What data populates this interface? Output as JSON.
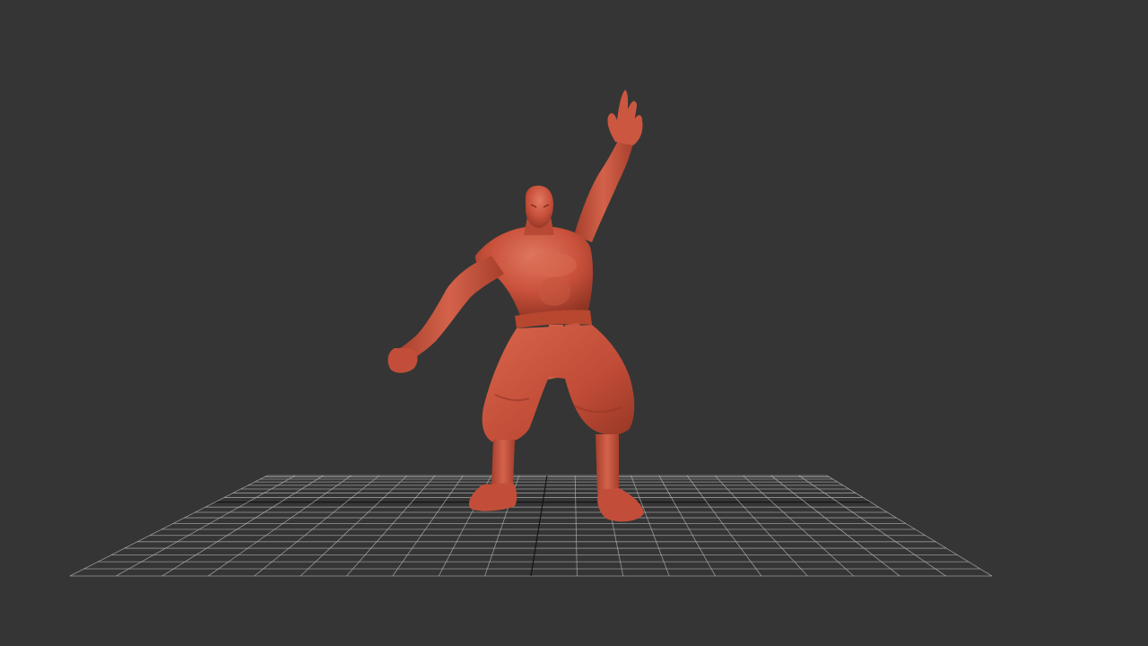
{
  "viewport": {
    "background_color": "#353535",
    "grid_line_color": "#b8b8b8",
    "grid_axis_color": "#111111",
    "model": {
      "icon": "character-model",
      "material_color": "#c9513b",
      "material_highlight": "#e07860",
      "material_shadow": "#8f3423"
    }
  }
}
